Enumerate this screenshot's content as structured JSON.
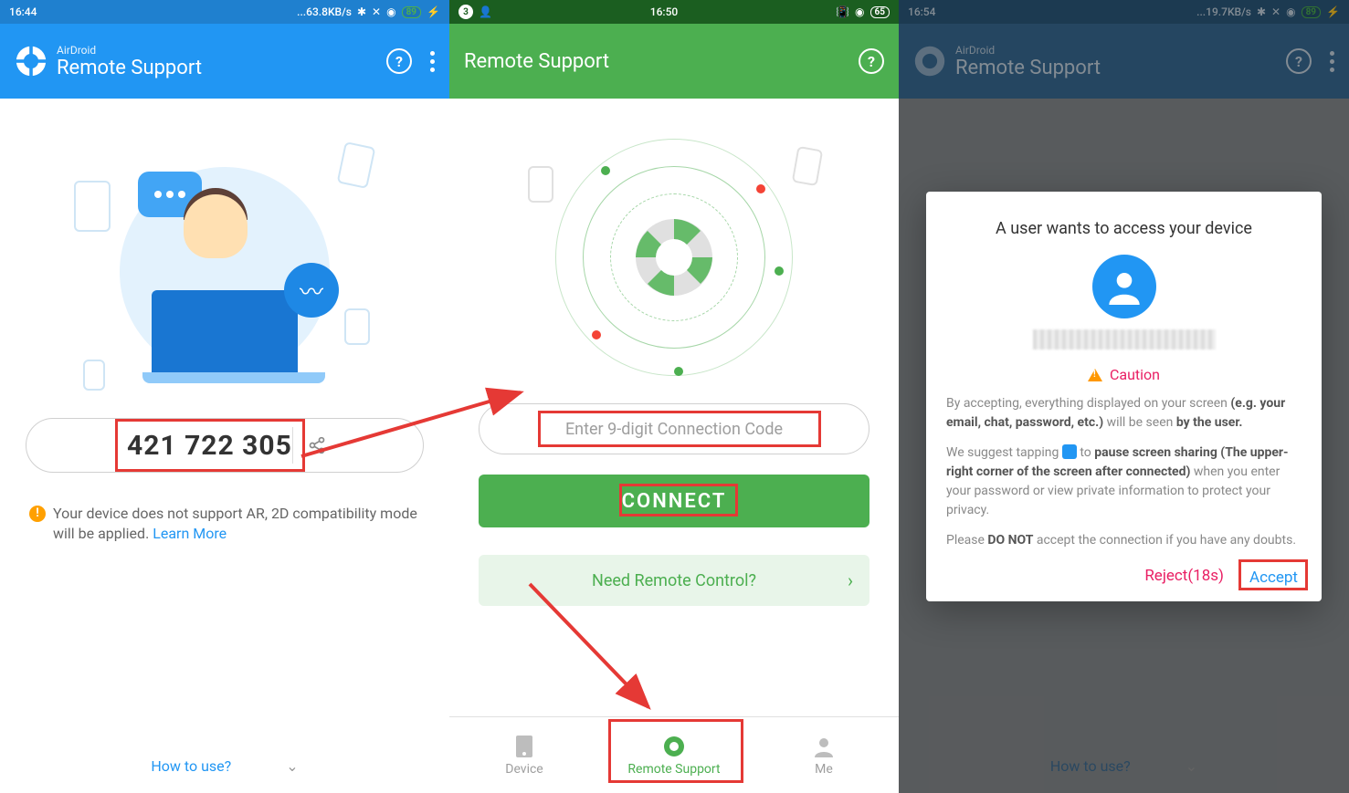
{
  "phone1": {
    "status": {
      "time": "16:44",
      "net": "...63.8KB/s",
      "battery": "89"
    },
    "header": {
      "small": "AirDroid",
      "title": "Remote Support"
    },
    "code": "421 722 305",
    "warning": "Your device does not support AR, 2D compatibility mode will be applied.",
    "learn_more": "Learn More",
    "howto": "How to use?"
  },
  "phone2": {
    "status": {
      "time": "16:50",
      "battery": "65",
      "notif": "3"
    },
    "header": {
      "title": "Remote Support"
    },
    "input_placeholder": "Enter 9-digit Connection Code",
    "connect_label": "CONNECT",
    "need_label": "Need Remote Control?",
    "nav": {
      "device": "Device",
      "remote": "Remote Support",
      "me": "Me"
    }
  },
  "phone3": {
    "status": {
      "time": "16:54",
      "net": "...19.7KB/s",
      "battery": "89"
    },
    "header": {
      "small": "AirDroid",
      "title": "Remote Support"
    },
    "dialog": {
      "title": "A user wants to access your device",
      "caution": "Caution",
      "p1a": "By accepting, everything displayed on your screen ",
      "p1b": "(e.g. your email, chat, password, etc.)",
      "p1c": " will be seen ",
      "p1d": "by the user.",
      "p2a": "We suggest tapping ",
      "p2b": " to ",
      "p2c": "pause screen sharing (The upper-right corner of the screen after connected)",
      "p2d": " when you enter your password or view private information to protect your privacy.",
      "p3a": "Please ",
      "p3b": "DO NOT",
      "p3c": " accept the connection if you have any doubts.",
      "reject": "Reject(18s)",
      "accept": "Accept"
    },
    "howto": "How to use?"
  }
}
